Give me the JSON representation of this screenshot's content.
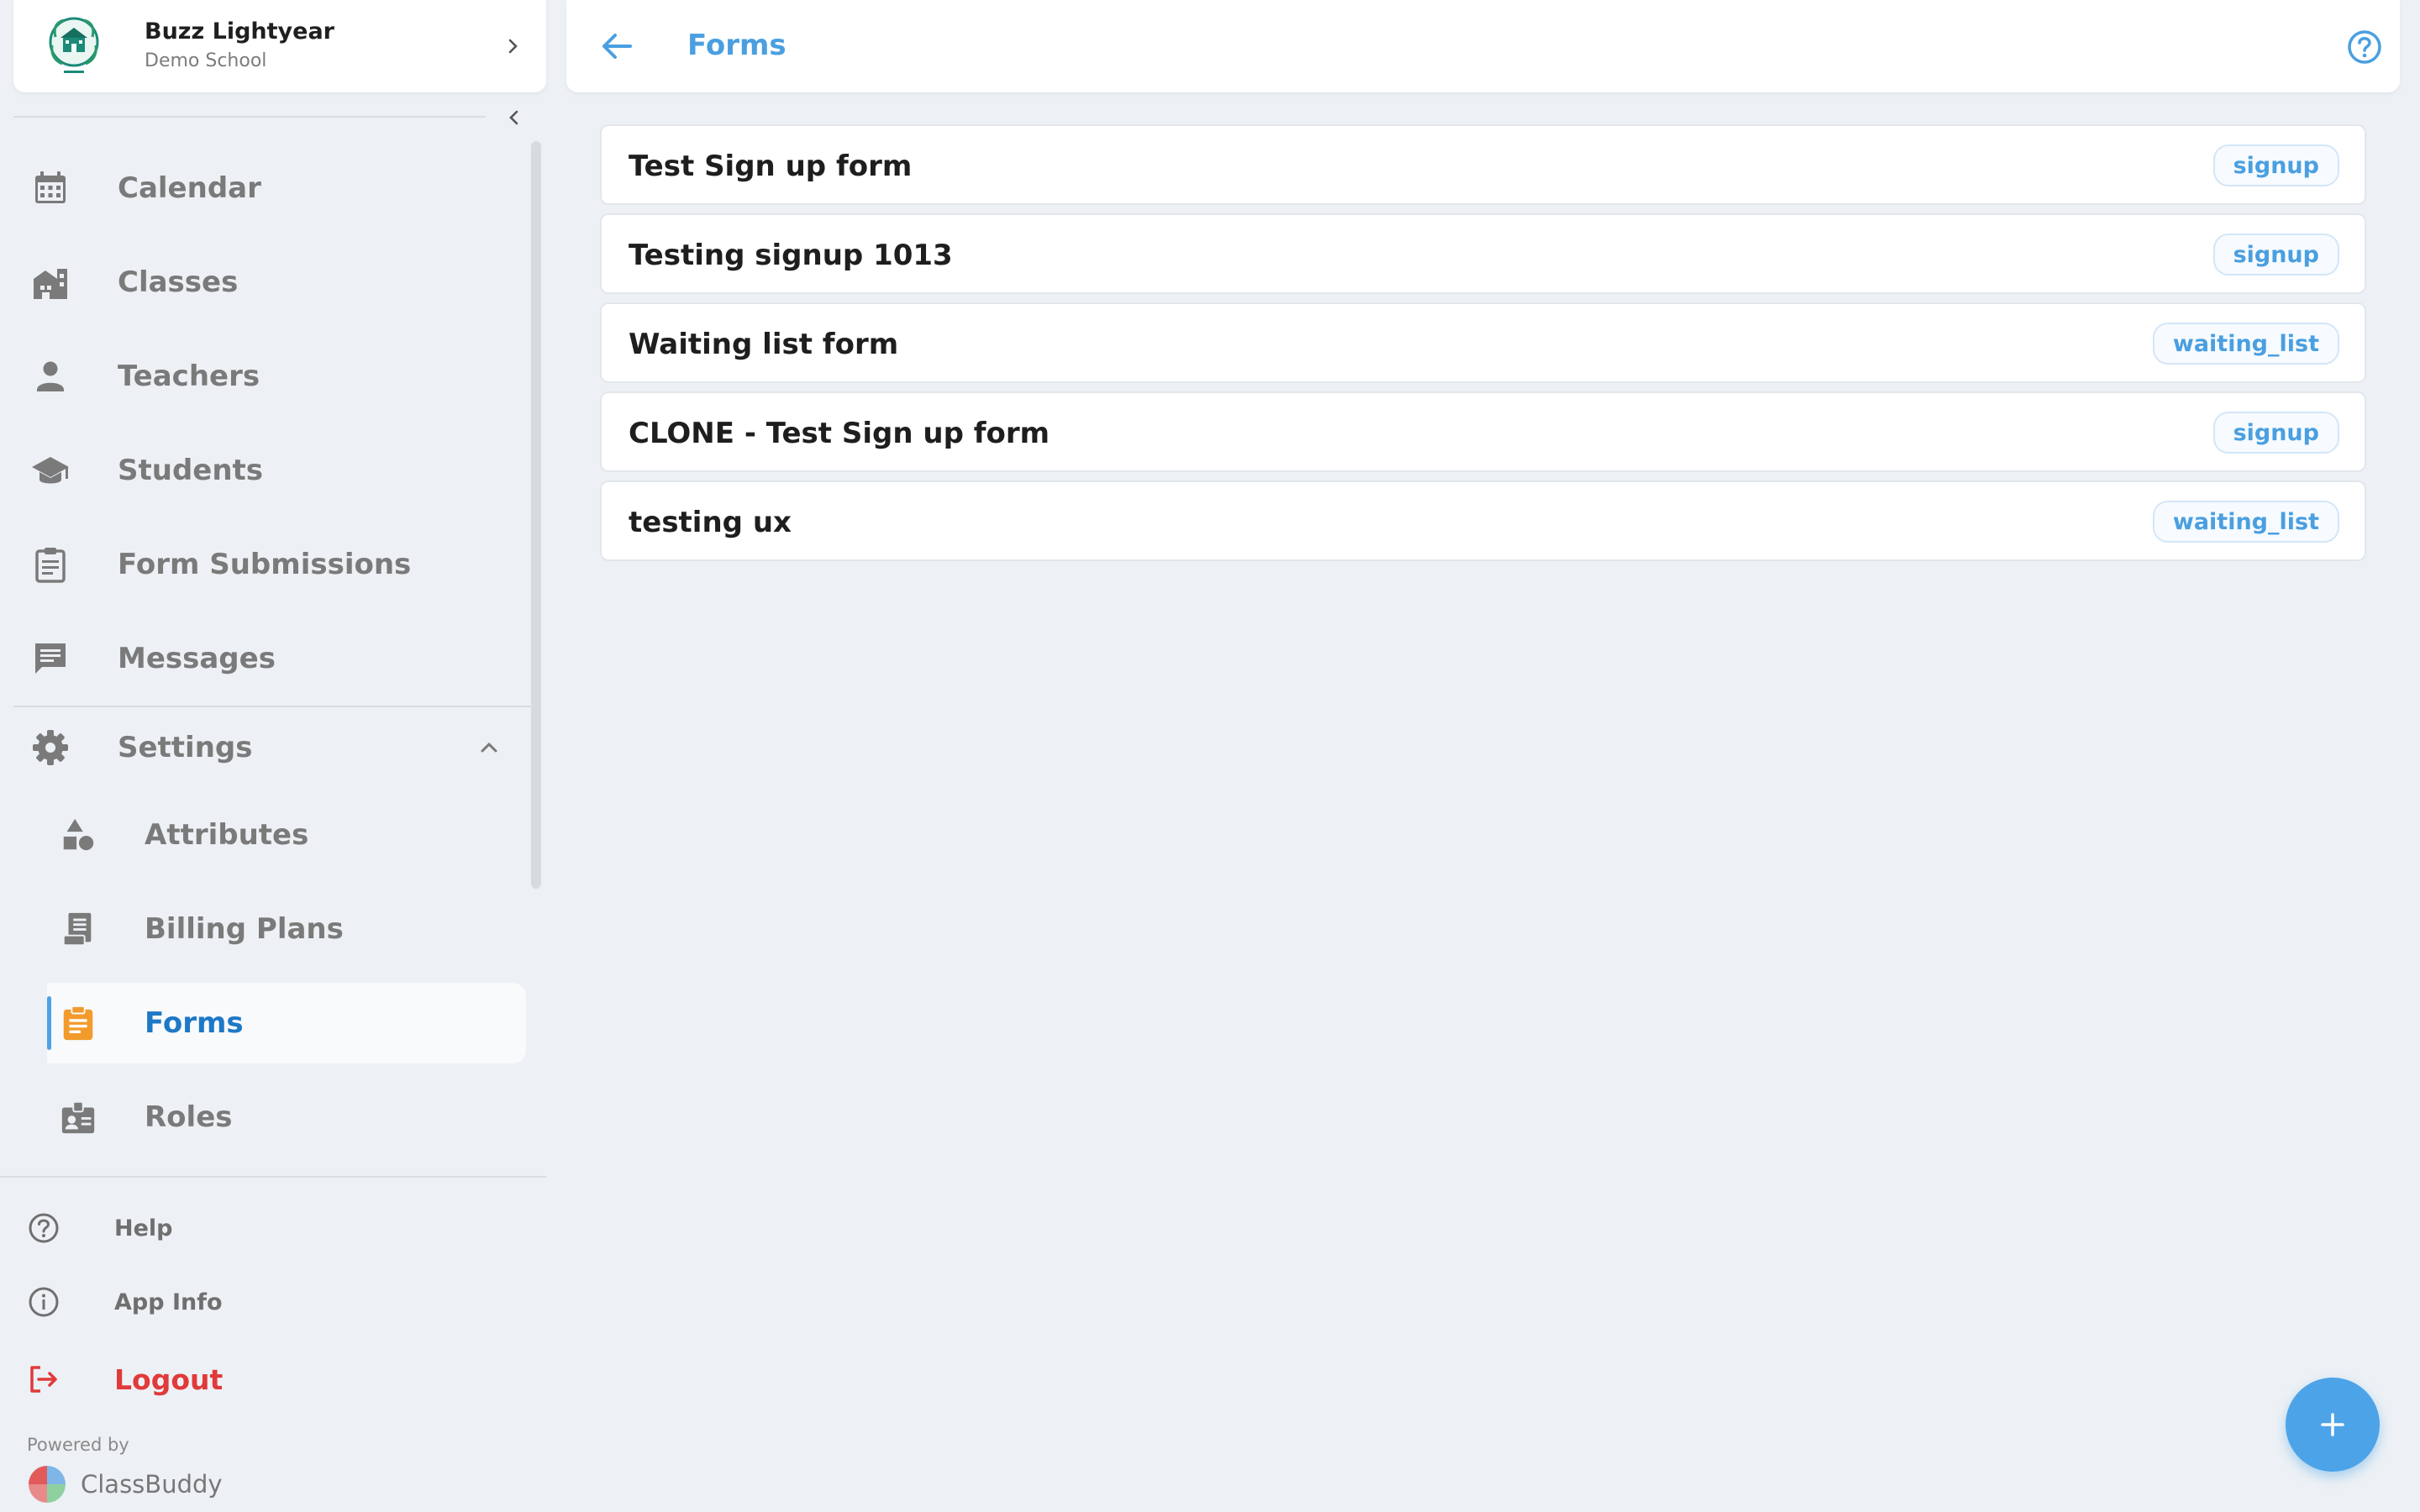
{
  "profile": {
    "name": "Buzz Lightyear",
    "school": "Demo School"
  },
  "nav": {
    "items": [
      {
        "label": "Calendar",
        "icon": "calendar-icon"
      },
      {
        "label": "Classes",
        "icon": "classes-icon"
      },
      {
        "label": "Teachers",
        "icon": "person-icon"
      },
      {
        "label": "Students",
        "icon": "graduation-cap-icon"
      },
      {
        "label": "Form Submissions",
        "icon": "clipboard-list-icon"
      },
      {
        "label": "Messages",
        "icon": "message-icon"
      }
    ],
    "settings": {
      "label": "Settings",
      "icon": "gear-icon",
      "expanded": true,
      "children": [
        {
          "label": "Attributes",
          "icon": "shapes-icon"
        },
        {
          "label": "Billing Plans",
          "icon": "receipt-icon"
        },
        {
          "label": "Forms",
          "icon": "form-clipboard-icon",
          "active": true
        },
        {
          "label": "Roles",
          "icon": "badge-icon"
        }
      ]
    }
  },
  "footer": {
    "help": "Help",
    "app_info": "App Info",
    "logout": "Logout",
    "powered_by": "Powered by",
    "brand": "ClassBuddy"
  },
  "header": {
    "title": "Forms"
  },
  "forms": [
    {
      "name": "Test Sign up form",
      "type": "signup"
    },
    {
      "name": "Testing signup 1013",
      "type": "signup"
    },
    {
      "name": "Waiting list form",
      "type": "waiting_list"
    },
    {
      "name": "CLONE - Test Sign up form",
      "type": "signup"
    },
    {
      "name": "testing ux",
      "type": "waiting_list"
    }
  ],
  "colors": {
    "accent": "#4da3e8",
    "active_icon": "#f29b2c",
    "logout": "#e03a3a",
    "icon_gray": "#7a7a7a"
  }
}
